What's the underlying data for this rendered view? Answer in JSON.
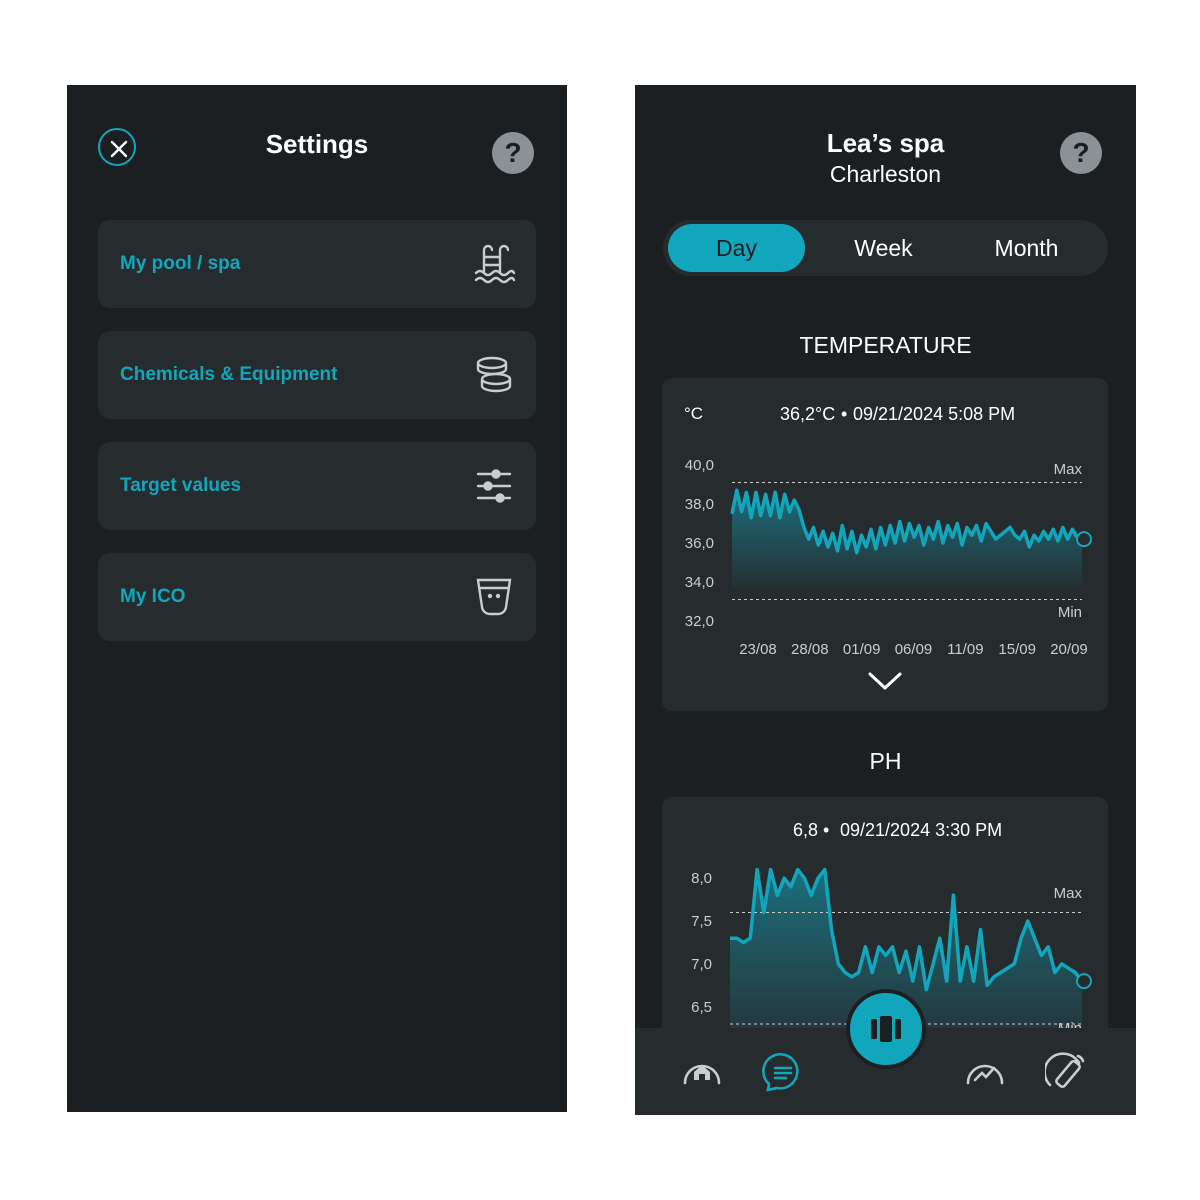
{
  "settings": {
    "title": "Settings",
    "help_label": "?",
    "items": [
      {
        "label": "My pool / spa",
        "icon": "pool-ladder-icon"
      },
      {
        "label": "Chemicals & Equipment",
        "icon": "chemical-tablets-icon"
      },
      {
        "label": "Target values",
        "icon": "sliders-icon"
      },
      {
        "label": "My ICO",
        "icon": "ico-device-icon"
      }
    ]
  },
  "spa": {
    "name": "Lea’s spa",
    "city": "Charleston",
    "help_label": "?",
    "tabs": [
      {
        "label": "Day",
        "active": true
      },
      {
        "label": "Week",
        "active": false
      },
      {
        "label": "Month",
        "active": false
      }
    ],
    "temperature_section": "TEMPERATURE",
    "ph_section": "PH",
    "expand_icon": "chevron-down-icon"
  },
  "colors": {
    "background": "#1b1f21",
    "card": "#262b2e",
    "accent": "#12a6bc",
    "text": "#ffffff",
    "muted": "#b9bec2"
  },
  "nav": {
    "items": [
      "home-icon",
      "chat-icon",
      "ico-device-icon",
      "dashboard-gauge-icon",
      "remote-control-icon"
    ],
    "active": "chat-icon"
  },
  "chart_data": [
    {
      "type": "area",
      "unit_label": "°C",
      "current_value": "36,2°C",
      "current_timestamp": "09/21/2024 5:08 PM",
      "x_tick_labels": [
        "23/08",
        "28/08",
        "01/09",
        "06/09",
        "11/09",
        "15/09",
        "20/09"
      ],
      "y_tick_labels": [
        "40,0",
        "38,0",
        "36,0",
        "34,0",
        "32,0"
      ],
      "ylim": [
        32,
        40
      ],
      "max_label": "Max",
      "min_label": "Min",
      "max_threshold": 39.1,
      "min_threshold": 33.1,
      "series": [
        {
          "values": [
            37.5,
            38.7,
            37.6,
            38.6,
            37.3,
            38.6,
            37.4,
            38.5,
            37.4,
            38.6,
            37.3,
            38.5,
            37.6,
            38.2,
            37.7,
            36.8,
            36.2,
            36.8,
            35.9,
            36.6,
            35.8,
            36.5,
            35.6,
            36.9,
            35.7,
            36.6,
            35.5,
            36.4,
            35.8,
            36.7,
            35.7,
            36.8,
            35.9,
            36.9,
            36.0,
            37.1,
            36.1,
            37.0,
            36.3,
            36.9,
            35.9,
            36.8,
            36.2,
            37.1,
            36.0,
            36.9,
            36.3,
            37.0,
            35.9,
            36.8,
            36.4,
            36.9,
            36.1,
            37.0,
            36.6,
            36.2,
            36.4,
            36.6,
            36.8,
            36.4,
            36.2,
            36.6,
            35.8,
            36.4,
            36.1,
            36.6,
            36.2,
            36.7,
            36.1,
            36.8,
            36.2,
            36.7,
            36.3,
            36.2
          ]
        }
      ]
    },
    {
      "type": "area",
      "current_value": "6,8",
      "current_timestamp": "09/21/2024 3:30 PM",
      "y_tick_labels": [
        "8,0",
        "7,5",
        "7,0",
        "6,5"
      ],
      "ylim": [
        6.3,
        8.2
      ],
      "max_label": "Max",
      "min_label": "Min",
      "max_threshold": 7.6,
      "min_threshold": 6.3,
      "series": [
        {
          "values": [
            7.3,
            7.3,
            7.25,
            7.3,
            8.1,
            7.6,
            8.1,
            7.8,
            8.0,
            7.9,
            8.1,
            8.0,
            7.8,
            8.0,
            8.1,
            7.4,
            7.0,
            6.9,
            6.85,
            6.9,
            7.2,
            6.9,
            7.2,
            7.1,
            7.2,
            6.9,
            7.15,
            6.8,
            7.2,
            6.7,
            7.0,
            7.3,
            6.8,
            7.8,
            6.8,
            7.2,
            6.8,
            7.4,
            6.75,
            6.85,
            6.9,
            6.95,
            7.0,
            7.3,
            7.5,
            7.3,
            7.1,
            7.2,
            6.9,
            7.0,
            6.95,
            6.9,
            6.8
          ]
        }
      ]
    }
  ]
}
